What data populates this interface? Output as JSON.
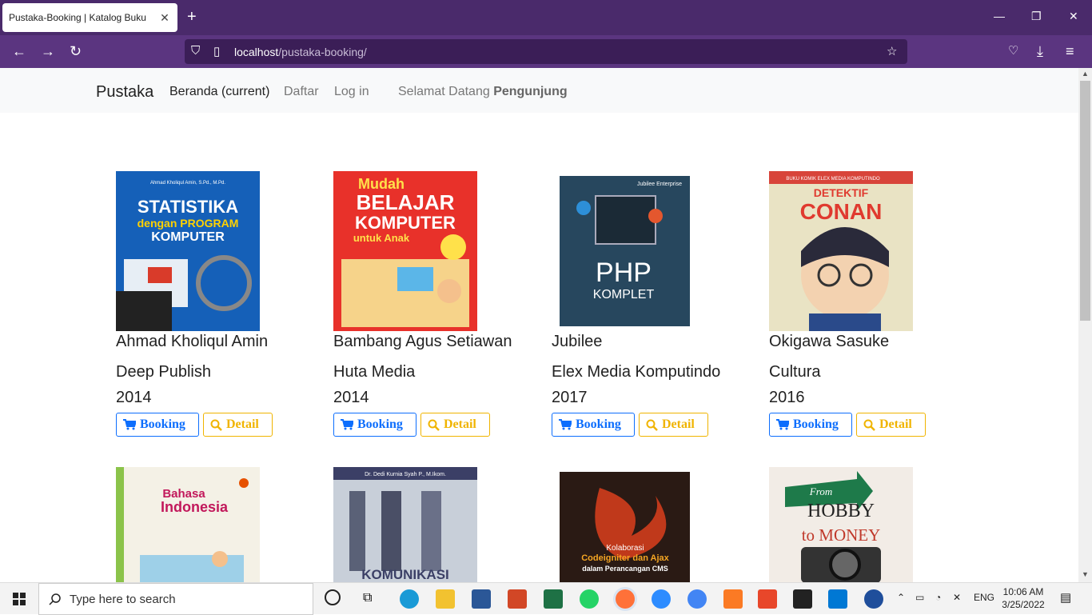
{
  "browser": {
    "tab_title": "Pustaka-Booking | Katalog Buku",
    "url_host": "localhost",
    "url_path": "/pustaka-booking/"
  },
  "nav": {
    "brand": "Pustaka",
    "home": "Beranda (current)",
    "register": "Daftar",
    "login": "Log in",
    "welcome_prefix": "Selamat Datang",
    "welcome_user": "Pengunjung"
  },
  "buttons": {
    "booking": "Booking",
    "detail": "Detail"
  },
  "books": [
    {
      "author": "Ahmad Kholiqul Amin",
      "publisher": "Deep Publish",
      "year": "2014",
      "cover_top": "Ahmad Kholiqul Amin, S.Pd., M.Pd.",
      "cover_title": "STATISTIKA",
      "cover_sub": "dengan PROGRAM",
      "cover_sub2": "KOMPUTER",
      "cover_color": "#1560b8"
    },
    {
      "author": "Bambang Agus Setiawan",
      "publisher": "Huta Media",
      "year": "2014",
      "cover_top": "Mudah",
      "cover_title": "BELAJAR",
      "cover_sub": "KOMPUTER",
      "cover_sub2": "untuk Anak",
      "cover_color": "#e8312a"
    },
    {
      "author": "Jubilee",
      "publisher": "Elex Media Komputindo",
      "year": "2017",
      "cover_top": "Jubilee Enterprise",
      "cover_title": "PHP",
      "cover_sub": "KOMPLET",
      "cover_sub2": "",
      "cover_color": "#27475e"
    },
    {
      "author": "Okigawa Sasuke",
      "publisher": "Cultura",
      "year": "2016",
      "cover_top": "BUKU KOMIK ELEX MEDIA KOMPUTINDO",
      "cover_title": "DETEKTIF",
      "cover_sub": "CONAN",
      "cover_sub2": "",
      "cover_color": "#e9e3c4"
    },
    {
      "cover_title": "Bahasa",
      "cover_sub": "Indonesia",
      "cover_color": "#f4f1e6"
    },
    {
      "cover_top": "Dr. Dedi Kurnia Syah P., M.Ikom.",
      "cover_title": "KOMUNIKASI",
      "cover_sub": "",
      "cover_color": "#c8cfd9"
    },
    {
      "cover_title": "Kolaborasi",
      "cover_sub": "Codeigniter dan Ajax",
      "cover_sub2": "dalam Perancangan CMS",
      "cover_color": "#2a1a14"
    },
    {
      "cover_title": "From",
      "cover_sub": "HOBBY",
      "cover_sub2": "to MONEY",
      "cover_color": "#f2ece6"
    }
  ],
  "taskbar": {
    "search_placeholder": "Type here to search",
    "lang": "ENG",
    "time": "10:06 AM",
    "date": "3/25/2022"
  }
}
